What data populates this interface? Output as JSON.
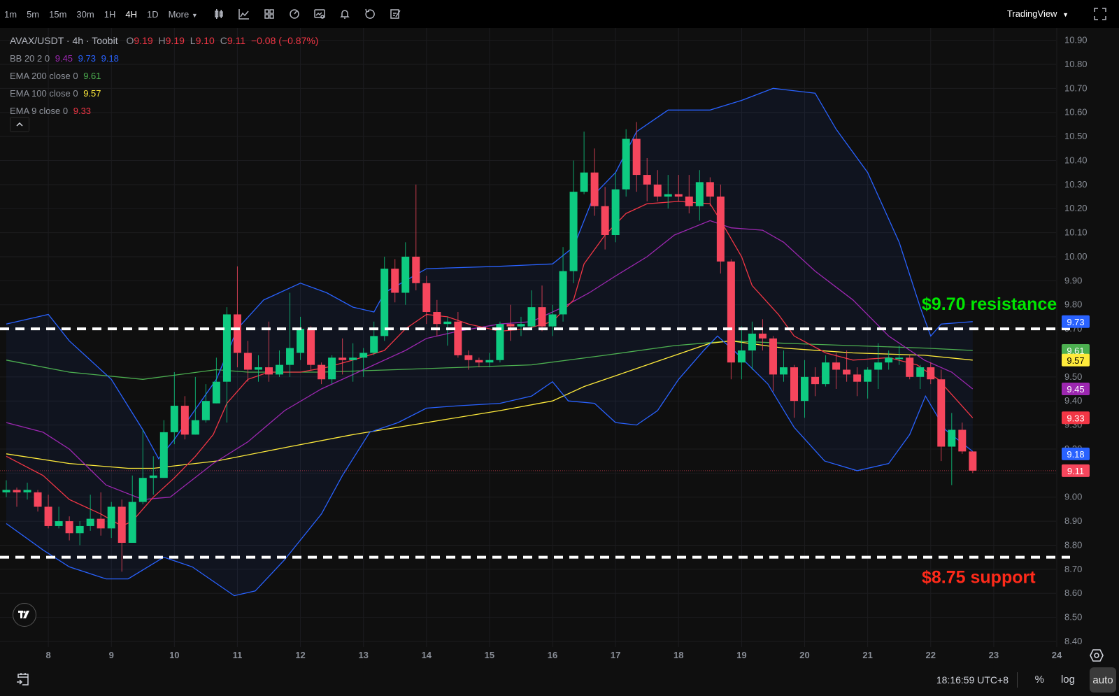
{
  "toolbar": {
    "intervals": [
      "1m",
      "5m",
      "15m",
      "30m",
      "1H",
      "4H",
      "1D"
    ],
    "active_interval": "4H",
    "more_label": "More",
    "icons": [
      "candles-icon",
      "line-chart-icon",
      "indicators-icon",
      "replay-icon",
      "chart-settings-icon",
      "alert-icon",
      "undo-icon",
      "note-icon"
    ],
    "brand": "TradingView"
  },
  "legend": {
    "symbol": "AVAX/USDT · 4h · Toobit",
    "o_label": "O",
    "o": "9.19",
    "h_label": "H",
    "h": "9.19",
    "l_label": "L",
    "l": "9.10",
    "c_label": "C",
    "c": "9.11",
    "change": "−0.08 (−0.87%)",
    "bb_label": "BB 20 2 0",
    "bb_mid": "9.45",
    "bb_upper": "9.73",
    "bb_lower": "9.18",
    "ema200_label": "EMA 200 close 0",
    "ema200": "9.61",
    "ema100_label": "EMA 100 close 0",
    "ema100": "9.57",
    "ema9_label": "EMA 9 close 0",
    "ema9": "9.33"
  },
  "colors": {
    "up": "#0ecb81",
    "down": "#f6465d",
    "bb_band": "#2962ff",
    "bb_mid": "#9c27b0",
    "ema9": "#f23645",
    "ema100": "#ffeb3b",
    "ema200": "#4caf50",
    "resistance": "#00e600",
    "support": "#ff2a1a"
  },
  "bottom": {
    "time": "18:16:59 UTC+8",
    "percent": "%",
    "log": "log",
    "auto": "auto",
    "logo": "TV"
  },
  "chart_data": {
    "type": "candlestick",
    "title": "AVAX/USDT · 4h · Toobit",
    "ylim": [
      8.35,
      10.95
    ],
    "yticks": [
      "10.90",
      "10.80",
      "10.70",
      "10.60",
      "10.50",
      "10.40",
      "10.30",
      "10.20",
      "10.10",
      "10.00",
      "9.90",
      "9.80",
      "9.70",
      "9.60",
      "9.50",
      "9.40",
      "9.30",
      "9.20",
      "9.10",
      "9.00",
      "8.90",
      "8.80",
      "8.70",
      "8.60",
      "8.50",
      "8.40"
    ],
    "xticks": [
      "8",
      "9",
      "10",
      "11",
      "12",
      "13",
      "14",
      "15",
      "16",
      "17",
      "18",
      "19",
      "20",
      "21",
      "22",
      "23",
      "24"
    ],
    "candles_per_day": 6,
    "first_day_tick_candle": 4,
    "candles": [
      [
        9.02,
        9.07,
        9.0,
        9.03
      ],
      [
        9.03,
        9.04,
        8.96,
        9.02
      ],
      [
        9.02,
        9.06,
        8.99,
        9.03
      ],
      [
        9.02,
        9.03,
        8.94,
        8.96
      ],
      [
        8.96,
        9.01,
        8.87,
        8.88
      ],
      [
        8.88,
        8.96,
        8.87,
        8.9
      ],
      [
        8.9,
        8.92,
        8.82,
        8.85
      ],
      [
        8.85,
        8.9,
        8.8,
        8.88
      ],
      [
        8.88,
        9.01,
        8.86,
        8.91
      ],
      [
        8.91,
        9.02,
        8.84,
        8.87
      ],
      [
        8.87,
        8.98,
        8.83,
        8.96
      ],
      [
        8.96,
        8.99,
        8.69,
        8.81
      ],
      [
        8.81,
        9.09,
        8.81,
        8.98
      ],
      [
        8.98,
        9.28,
        8.97,
        9.08
      ],
      [
        9.08,
        9.17,
        9.01,
        9.09
      ],
      [
        9.08,
        9.32,
        9.08,
        9.27
      ],
      [
        9.27,
        9.52,
        9.22,
        9.38
      ],
      [
        9.38,
        9.42,
        9.24,
        9.26
      ],
      [
        9.26,
        9.5,
        9.26,
        9.32
      ],
      [
        9.32,
        9.47,
        9.31,
        9.4
      ],
      [
        9.39,
        9.58,
        9.39,
        9.48
      ],
      [
        9.48,
        9.79,
        9.31,
        9.76
      ],
      [
        9.76,
        9.96,
        9.54,
        9.6
      ],
      [
        9.6,
        9.65,
        9.48,
        9.53
      ],
      [
        9.53,
        9.59,
        9.48,
        9.54
      ],
      [
        9.54,
        9.73,
        9.48,
        9.51
      ],
      [
        9.51,
        9.61,
        9.5,
        9.55
      ],
      [
        9.55,
        9.85,
        9.5,
        9.62
      ],
      [
        9.6,
        9.75,
        9.57,
        9.7
      ],
      [
        9.7,
        9.71,
        9.53,
        9.55
      ],
      [
        9.55,
        9.56,
        9.47,
        9.49
      ],
      [
        9.49,
        9.59,
        9.47,
        9.58
      ],
      [
        9.58,
        9.66,
        9.51,
        9.57
      ],
      [
        9.57,
        9.64,
        9.48,
        9.58
      ],
      [
        9.58,
        9.62,
        9.5,
        9.6
      ],
      [
        9.6,
        9.73,
        9.59,
        9.67
      ],
      [
        9.67,
        10.0,
        9.65,
        9.95
      ],
      [
        9.95,
        9.99,
        9.81,
        9.85
      ],
      [
        9.85,
        10.06,
        9.8,
        10.0
      ],
      [
        10.0,
        10.3,
        9.86,
        9.89
      ],
      [
        9.89,
        9.92,
        9.72,
        9.77
      ],
      [
        9.77,
        9.82,
        9.67,
        9.72
      ],
      [
        9.72,
        9.75,
        9.63,
        9.73
      ],
      [
        9.73,
        9.77,
        9.58,
        9.59
      ],
      [
        9.59,
        9.61,
        9.53,
        9.57
      ],
      [
        9.57,
        9.58,
        9.54,
        9.56
      ],
      [
        9.56,
        9.6,
        9.54,
        9.57
      ],
      [
        9.57,
        9.73,
        9.56,
        9.72
      ],
      [
        9.72,
        9.8,
        9.65,
        9.71
      ],
      [
        9.71,
        9.75,
        9.67,
        9.72
      ],
      [
        9.71,
        9.86,
        9.7,
        9.79
      ],
      [
        9.79,
        9.88,
        9.69,
        9.71
      ],
      [
        9.71,
        9.8,
        9.67,
        9.76
      ],
      [
        9.76,
        10.04,
        9.73,
        9.94
      ],
      [
        9.94,
        10.4,
        9.89,
        10.27
      ],
      [
        10.27,
        10.52,
        10.26,
        10.35
      ],
      [
        10.35,
        10.45,
        10.17,
        10.21
      ],
      [
        10.21,
        10.29,
        10.03,
        10.09
      ],
      [
        10.09,
        10.35,
        10.06,
        10.28
      ],
      [
        10.28,
        10.53,
        10.25,
        10.49
      ],
      [
        10.49,
        10.56,
        10.27,
        10.34
      ],
      [
        10.34,
        10.41,
        10.23,
        10.3
      ],
      [
        10.3,
        10.36,
        10.23,
        10.25
      ],
      [
        10.25,
        10.34,
        10.2,
        10.26
      ],
      [
        10.26,
        10.34,
        10.23,
        10.25
      ],
      [
        10.25,
        10.34,
        10.18,
        10.21
      ],
      [
        10.21,
        10.36,
        10.15,
        10.31
      ],
      [
        10.31,
        10.33,
        10.21,
        10.25
      ],
      [
        10.25,
        10.3,
        9.93,
        9.98
      ],
      [
        9.98,
        9.99,
        9.49,
        9.56
      ],
      [
        9.56,
        9.71,
        9.49,
        9.61
      ],
      [
        9.61,
        9.73,
        9.53,
        9.68
      ],
      [
        9.68,
        9.74,
        9.61,
        9.66
      ],
      [
        9.66,
        9.67,
        9.44,
        9.51
      ],
      [
        9.51,
        9.61,
        9.48,
        9.54
      ],
      [
        9.54,
        9.55,
        9.33,
        9.4
      ],
      [
        9.4,
        9.57,
        9.33,
        9.5
      ],
      [
        9.5,
        9.54,
        9.42,
        9.47
      ],
      [
        9.47,
        9.59,
        9.46,
        9.56
      ],
      [
        9.56,
        9.6,
        9.45,
        9.53
      ],
      [
        9.53,
        9.61,
        9.48,
        9.51
      ],
      [
        9.51,
        9.54,
        9.42,
        9.48
      ],
      [
        9.48,
        9.54,
        9.41,
        9.53
      ],
      [
        9.53,
        9.64,
        9.45,
        9.56
      ],
      [
        9.56,
        9.61,
        9.53,
        9.58
      ],
      [
        9.58,
        9.63,
        9.55,
        9.58
      ],
      [
        9.58,
        9.59,
        9.49,
        9.5
      ],
      [
        9.5,
        9.55,
        9.45,
        9.54
      ],
      [
        9.54,
        9.56,
        9.47,
        9.49
      ],
      [
        9.49,
        9.53,
        9.15,
        9.21
      ],
      [
        9.21,
        9.35,
        9.05,
        9.28
      ],
      [
        9.28,
        9.31,
        9.18,
        9.19
      ],
      [
        9.19,
        9.19,
        9.1,
        9.11
      ]
    ],
    "indicators": {
      "bb_upper": [
        [
          0,
          9.72
        ],
        [
          4,
          9.76
        ],
        [
          6,
          9.65
        ],
        [
          10,
          9.49
        ],
        [
          13,
          9.28
        ],
        [
          14.5,
          9.16
        ],
        [
          16,
          9.24
        ],
        [
          20,
          9.49
        ],
        [
          22,
          9.7
        ],
        [
          24.5,
          9.82
        ],
        [
          28,
          9.89
        ],
        [
          30.5,
          9.85
        ],
        [
          33,
          9.79
        ],
        [
          35,
          9.77
        ],
        [
          36,
          9.85
        ],
        [
          40,
          9.95
        ],
        [
          47,
          9.96
        ],
        [
          52,
          9.97
        ],
        [
          54,
          10.04
        ],
        [
          56,
          10.26
        ],
        [
          58,
          10.35
        ],
        [
          60,
          10.52
        ],
        [
          63,
          10.61
        ],
        [
          67,
          10.61
        ],
        [
          70,
          10.65
        ],
        [
          73,
          10.7
        ],
        [
          77,
          10.68
        ],
        [
          79,
          10.53
        ],
        [
          82,
          10.35
        ],
        [
          85,
          10.06
        ],
        [
          87,
          9.79
        ],
        [
          88,
          9.67
        ],
        [
          89,
          9.72
        ],
        [
          92,
          9.73
        ]
      ],
      "bb_mid": [
        [
          0,
          9.31
        ],
        [
          3.5,
          9.27
        ],
        [
          6,
          9.2
        ],
        [
          9.5,
          9.05
        ],
        [
          13,
          8.99
        ],
        [
          15.6,
          9.0
        ],
        [
          19.7,
          9.14
        ],
        [
          23,
          9.23
        ],
        [
          26.5,
          9.36
        ],
        [
          30,
          9.45
        ],
        [
          33,
          9.51
        ],
        [
          35,
          9.55
        ],
        [
          38,
          9.61
        ],
        [
          40,
          9.66
        ],
        [
          43,
          9.69
        ],
        [
          47,
          9.72
        ],
        [
          50,
          9.73
        ],
        [
          53,
          9.79
        ],
        [
          55.5,
          9.85
        ],
        [
          58,
          9.92
        ],
        [
          61,
          10.0
        ],
        [
          63.6,
          10.09
        ],
        [
          67,
          10.15
        ],
        [
          69,
          10.12
        ],
        [
          72,
          10.11
        ],
        [
          74,
          10.06
        ],
        [
          77,
          9.94
        ],
        [
          80.6,
          9.82
        ],
        [
          84,
          9.67
        ],
        [
          87.4,
          9.57
        ],
        [
          90,
          9.52
        ],
        [
          92,
          9.45
        ]
      ],
      "bb_lower": [
        [
          0,
          8.89
        ],
        [
          3.5,
          8.78
        ],
        [
          6,
          8.71
        ],
        [
          9.5,
          8.66
        ],
        [
          11.6,
          8.66
        ],
        [
          15,
          8.75
        ],
        [
          17.7,
          8.71
        ],
        [
          19.7,
          8.65
        ],
        [
          21.7,
          8.59
        ],
        [
          23.7,
          8.61
        ],
        [
          26.5,
          8.74
        ],
        [
          30,
          8.93
        ],
        [
          32,
          9.09
        ],
        [
          34.6,
          9.27
        ],
        [
          37.3,
          9.31
        ],
        [
          40,
          9.37
        ],
        [
          43,
          9.38
        ],
        [
          47,
          9.39
        ],
        [
          50,
          9.42
        ],
        [
          52,
          9.48
        ],
        [
          53.5,
          9.4
        ],
        [
          56,
          9.39
        ],
        [
          58,
          9.31
        ],
        [
          60,
          9.3
        ],
        [
          62,
          9.36
        ],
        [
          64,
          9.49
        ],
        [
          66.4,
          9.61
        ],
        [
          67.7,
          9.67
        ],
        [
          69.5,
          9.6
        ],
        [
          72.5,
          9.47
        ],
        [
          75,
          9.29
        ],
        [
          77.9,
          9.15
        ],
        [
          81,
          9.11
        ],
        [
          84,
          9.14
        ],
        [
          86,
          9.26
        ],
        [
          87.5,
          9.42
        ],
        [
          89.4,
          9.28
        ],
        [
          92,
          9.19
        ]
      ],
      "ema9": [
        [
          0,
          9.17
        ],
        [
          3.5,
          9.09
        ],
        [
          6,
          8.99
        ],
        [
          9,
          8.93
        ],
        [
          11,
          8.88
        ],
        [
          12,
          8.9
        ],
        [
          14,
          9.0
        ],
        [
          16,
          9.08
        ],
        [
          18,
          9.17
        ],
        [
          19.7,
          9.26
        ],
        [
          21,
          9.39
        ],
        [
          23,
          9.49
        ],
        [
          25,
          9.52
        ],
        [
          28,
          9.52
        ],
        [
          30.5,
          9.54
        ],
        [
          33,
          9.57
        ],
        [
          36,
          9.61
        ],
        [
          38,
          9.7
        ],
        [
          40,
          9.76
        ],
        [
          42,
          9.75
        ],
        [
          44,
          9.72
        ],
        [
          47,
          9.69
        ],
        [
          49.5,
          9.7
        ],
        [
          52,
          9.73
        ],
        [
          54,
          9.82
        ],
        [
          55,
          9.97
        ],
        [
          57,
          10.09
        ],
        [
          59,
          10.18
        ],
        [
          61,
          10.22
        ],
        [
          64,
          10.23
        ],
        [
          67,
          10.22
        ],
        [
          68,
          10.15
        ],
        [
          70,
          10.0
        ],
        [
          71,
          9.88
        ],
        [
          73.5,
          9.76
        ],
        [
          75,
          9.67
        ],
        [
          78,
          9.6
        ],
        [
          80.6,
          9.57
        ],
        [
          84,
          9.58
        ],
        [
          86.7,
          9.55
        ],
        [
          88.7,
          9.49
        ],
        [
          92,
          9.33
        ]
      ],
      "ema100": [
        [
          0,
          9.18
        ],
        [
          6,
          9.14
        ],
        [
          11.6,
          9.12
        ],
        [
          14,
          9.12
        ],
        [
          20,
          9.15
        ],
        [
          27,
          9.21
        ],
        [
          33,
          9.26
        ],
        [
          40,
          9.31
        ],
        [
          47,
          9.36
        ],
        [
          52,
          9.4
        ],
        [
          55,
          9.46
        ],
        [
          59,
          9.52
        ],
        [
          63,
          9.58
        ],
        [
          67,
          9.64
        ],
        [
          69,
          9.65
        ],
        [
          74,
          9.62
        ],
        [
          80.6,
          9.6
        ],
        [
          87.4,
          9.59
        ],
        [
          92,
          9.57
        ]
      ],
      "ema200": [
        [
          0,
          9.57
        ],
        [
          6,
          9.52
        ],
        [
          13,
          9.49
        ],
        [
          20,
          9.53
        ],
        [
          23,
          9.52
        ],
        [
          30,
          9.52
        ],
        [
          37,
          9.53
        ],
        [
          43.4,
          9.54
        ],
        [
          50,
          9.55
        ],
        [
          57,
          9.59
        ],
        [
          63.6,
          9.63
        ],
        [
          69,
          9.65
        ],
        [
          74,
          9.64
        ],
        [
          80.6,
          9.63
        ],
        [
          87.4,
          9.62
        ],
        [
          92,
          9.61
        ]
      ]
    },
    "price_badges": [
      {
        "label": "9.73",
        "value": 9.73,
        "color": "#2962ff",
        "text": "#ffffff"
      },
      {
        "label": "9.61",
        "value": 9.61,
        "color": "#4caf50",
        "text": "#ffffff"
      },
      {
        "label": "9.57",
        "value": 9.57,
        "color": "#ffeb3b",
        "text": "#000000"
      },
      {
        "label": "9.45",
        "value": 9.45,
        "color": "#9c27b0",
        "text": "#ffffff"
      },
      {
        "label": "9.33",
        "value": 9.33,
        "color": "#f23645",
        "text": "#ffffff"
      },
      {
        "label": "9.18",
        "value": 9.18,
        "color": "#2962ff",
        "text": "#ffffff"
      },
      {
        "label": "9.11",
        "value": 9.11,
        "color": "#f6465d",
        "text": "#ffffff"
      }
    ],
    "last_price": 9.11,
    "levels": [
      {
        "price": 9.7,
        "label": "$9.70 resistance",
        "color": "#00e600",
        "side": "above"
      },
      {
        "price": 8.75,
        "label": "$8.75 support",
        "color": "#ff2a1a",
        "side": "below"
      }
    ]
  }
}
